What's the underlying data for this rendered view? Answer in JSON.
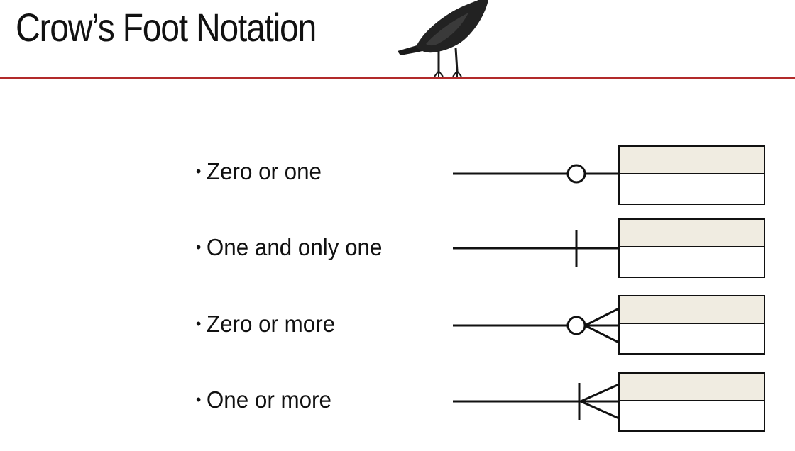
{
  "slide": {
    "title": "Crow’s Foot Notation",
    "accent_color": "#b22a2a",
    "decoration_icon": "crow-icon"
  },
  "items": [
    {
      "label": "Zero or one",
      "symbol": "zero-or-one"
    },
    {
      "label": "One and only one",
      "symbol": "one-and-only-one"
    },
    {
      "label": "Zero or more",
      "symbol": "zero-or-more"
    },
    {
      "label": "One or more",
      "symbol": "one-or-more"
    }
  ],
  "entity_colors": {
    "header_fill": "#f0ece1",
    "body_fill": "#ffffff",
    "stroke": "#111111"
  }
}
